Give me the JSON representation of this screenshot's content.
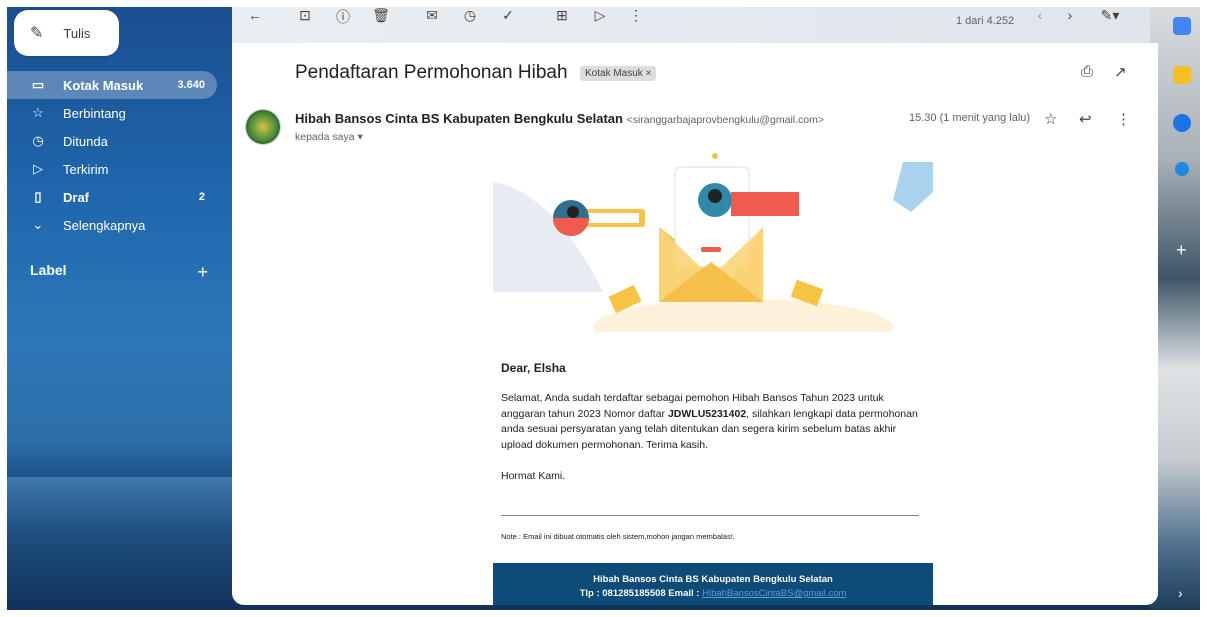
{
  "sidebar": {
    "compose_label": "Tulis",
    "items": [
      {
        "label": "Kotak Masuk",
        "count": "3.640"
      },
      {
        "label": "Berbintang",
        "count": ""
      },
      {
        "label": "Ditunda",
        "count": ""
      },
      {
        "label": "Terkirim",
        "count": ""
      },
      {
        "label": "Draf",
        "count": "2"
      },
      {
        "label": "Selengkapnya",
        "count": ""
      }
    ],
    "label_heading": "Label"
  },
  "toolbar": {
    "pager": "1 dari 4.252"
  },
  "message": {
    "subject": "Pendaftaran Permohonan Hibah",
    "inbox_chip": "Kotak Masuk ×",
    "sender_name": "Hibah Bansos Cinta BS Kabupaten Bengkulu Selatan",
    "sender_email": "<siranggarbajaprovbengkulu@gmail.com>",
    "recipient": "kepada saya ▾",
    "time": "15.30 (1 menit yang lalu)"
  },
  "email_body": {
    "greeting": "Dear, Elsha",
    "para_before": "Selamat, Anda sudah terdaftar sebagai pemohon Hibah Bansos Tahun 2023 untuk anggaran tahun 2023 Nomor daftar ",
    "reg_number": "JDWLU5231402",
    "para_after": ", silahkan lengkapi data permohonan anda sesuai persyaratan yang telah ditentukan dan segera kirim sebelum batas akhir upload dokumen permohonan. Terima kasih.",
    "regards": "Hormat Kami.",
    "note": "Note : Email ini dibuat otomatis oleh sistem,mohon jangan membalas!.",
    "footer_title": "Hibah Bansos Cinta BS Kabupaten Bengkulu Selatan",
    "footer_contact": "Tlp : 081285185508 Email : ",
    "footer_email": "HibahBansosCintaBS@gmail.com"
  },
  "icons": {
    "compose": "pencil-icon",
    "inbox": "inbox-icon",
    "starred": "star-icon",
    "snoozed": "clock-icon",
    "sent": "send-icon",
    "drafts": "draft-icon",
    "more": "chevron-down-icon"
  },
  "colors": {
    "footer_bg": "#0d4b78",
    "accent_red": "#ef5b4c",
    "accent_yellow": "#f6c343"
  }
}
